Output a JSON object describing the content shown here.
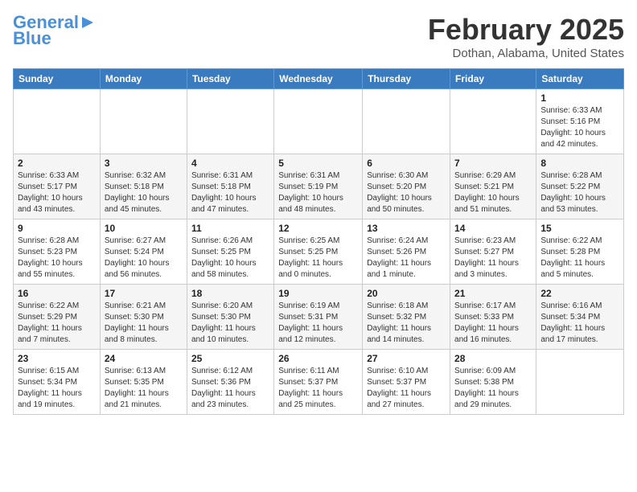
{
  "header": {
    "logo_line1": "General",
    "logo_line2": "Blue",
    "month_year": "February 2025",
    "location": "Dothan, Alabama, United States"
  },
  "days_of_week": [
    "Sunday",
    "Monday",
    "Tuesday",
    "Wednesday",
    "Thursday",
    "Friday",
    "Saturday"
  ],
  "weeks": [
    [
      {
        "day": "",
        "info": ""
      },
      {
        "day": "",
        "info": ""
      },
      {
        "day": "",
        "info": ""
      },
      {
        "day": "",
        "info": ""
      },
      {
        "day": "",
        "info": ""
      },
      {
        "day": "",
        "info": ""
      },
      {
        "day": "1",
        "info": "Sunrise: 6:33 AM\nSunset: 5:16 PM\nDaylight: 10 hours\nand 42 minutes."
      }
    ],
    [
      {
        "day": "2",
        "info": "Sunrise: 6:33 AM\nSunset: 5:17 PM\nDaylight: 10 hours\nand 43 minutes."
      },
      {
        "day": "3",
        "info": "Sunrise: 6:32 AM\nSunset: 5:18 PM\nDaylight: 10 hours\nand 45 minutes."
      },
      {
        "day": "4",
        "info": "Sunrise: 6:31 AM\nSunset: 5:18 PM\nDaylight: 10 hours\nand 47 minutes."
      },
      {
        "day": "5",
        "info": "Sunrise: 6:31 AM\nSunset: 5:19 PM\nDaylight: 10 hours\nand 48 minutes."
      },
      {
        "day": "6",
        "info": "Sunrise: 6:30 AM\nSunset: 5:20 PM\nDaylight: 10 hours\nand 50 minutes."
      },
      {
        "day": "7",
        "info": "Sunrise: 6:29 AM\nSunset: 5:21 PM\nDaylight: 10 hours\nand 51 minutes."
      },
      {
        "day": "8",
        "info": "Sunrise: 6:28 AM\nSunset: 5:22 PM\nDaylight: 10 hours\nand 53 minutes."
      }
    ],
    [
      {
        "day": "9",
        "info": "Sunrise: 6:28 AM\nSunset: 5:23 PM\nDaylight: 10 hours\nand 55 minutes."
      },
      {
        "day": "10",
        "info": "Sunrise: 6:27 AM\nSunset: 5:24 PM\nDaylight: 10 hours\nand 56 minutes."
      },
      {
        "day": "11",
        "info": "Sunrise: 6:26 AM\nSunset: 5:25 PM\nDaylight: 10 hours\nand 58 minutes."
      },
      {
        "day": "12",
        "info": "Sunrise: 6:25 AM\nSunset: 5:25 PM\nDaylight: 11 hours\nand 0 minutes."
      },
      {
        "day": "13",
        "info": "Sunrise: 6:24 AM\nSunset: 5:26 PM\nDaylight: 11 hours\nand 1 minute."
      },
      {
        "day": "14",
        "info": "Sunrise: 6:23 AM\nSunset: 5:27 PM\nDaylight: 11 hours\nand 3 minutes."
      },
      {
        "day": "15",
        "info": "Sunrise: 6:22 AM\nSunset: 5:28 PM\nDaylight: 11 hours\nand 5 minutes."
      }
    ],
    [
      {
        "day": "16",
        "info": "Sunrise: 6:22 AM\nSunset: 5:29 PM\nDaylight: 11 hours\nand 7 minutes."
      },
      {
        "day": "17",
        "info": "Sunrise: 6:21 AM\nSunset: 5:30 PM\nDaylight: 11 hours\nand 8 minutes."
      },
      {
        "day": "18",
        "info": "Sunrise: 6:20 AM\nSunset: 5:30 PM\nDaylight: 11 hours\nand 10 minutes."
      },
      {
        "day": "19",
        "info": "Sunrise: 6:19 AM\nSunset: 5:31 PM\nDaylight: 11 hours\nand 12 minutes."
      },
      {
        "day": "20",
        "info": "Sunrise: 6:18 AM\nSunset: 5:32 PM\nDaylight: 11 hours\nand 14 minutes."
      },
      {
        "day": "21",
        "info": "Sunrise: 6:17 AM\nSunset: 5:33 PM\nDaylight: 11 hours\nand 16 minutes."
      },
      {
        "day": "22",
        "info": "Sunrise: 6:16 AM\nSunset: 5:34 PM\nDaylight: 11 hours\nand 17 minutes."
      }
    ],
    [
      {
        "day": "23",
        "info": "Sunrise: 6:15 AM\nSunset: 5:34 PM\nDaylight: 11 hours\nand 19 minutes."
      },
      {
        "day": "24",
        "info": "Sunrise: 6:13 AM\nSunset: 5:35 PM\nDaylight: 11 hours\nand 21 minutes."
      },
      {
        "day": "25",
        "info": "Sunrise: 6:12 AM\nSunset: 5:36 PM\nDaylight: 11 hours\nand 23 minutes."
      },
      {
        "day": "26",
        "info": "Sunrise: 6:11 AM\nSunset: 5:37 PM\nDaylight: 11 hours\nand 25 minutes."
      },
      {
        "day": "27",
        "info": "Sunrise: 6:10 AM\nSunset: 5:37 PM\nDaylight: 11 hours\nand 27 minutes."
      },
      {
        "day": "28",
        "info": "Sunrise: 6:09 AM\nSunset: 5:38 PM\nDaylight: 11 hours\nand 29 minutes."
      },
      {
        "day": "",
        "info": ""
      }
    ]
  ]
}
